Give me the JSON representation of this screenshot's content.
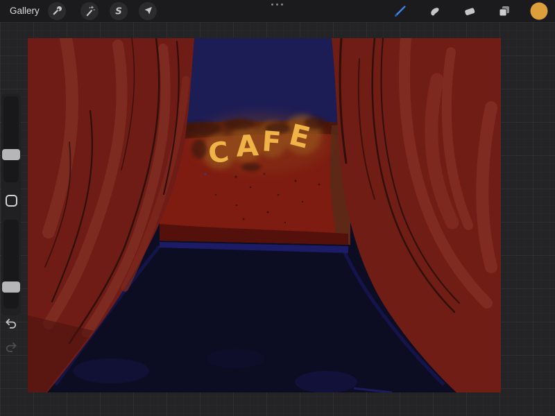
{
  "topbar": {
    "gallery_label": "Gallery",
    "left_tools": [
      {
        "id": "actions",
        "icon": "wrench-icon"
      },
      {
        "id": "adjustments",
        "icon": "magic-wand-icon"
      },
      {
        "id": "selection",
        "icon": "selection-s-icon",
        "glyph": "S"
      },
      {
        "id": "transform",
        "icon": "transform-arrow-icon"
      }
    ],
    "right_tools": [
      {
        "id": "paint",
        "icon": "paintbrush-icon",
        "active": true,
        "accent_color": "#3d85ea"
      },
      {
        "id": "smudge",
        "icon": "smudge-icon"
      },
      {
        "id": "erase",
        "icon": "eraser-icon"
      },
      {
        "id": "layers",
        "icon": "layers-icon"
      },
      {
        "id": "color",
        "icon": "color-swatch",
        "swatch_color": "#dd9f3c"
      }
    ]
  },
  "sidebar": {
    "sliders": [
      {
        "id": "brush-size",
        "handle_position_pct_from_top": 69
      },
      {
        "id": "opacity",
        "handle_position_pct_from_top": 76
      }
    ],
    "has_modify_button": true,
    "history": [
      "undo",
      "redo"
    ]
  },
  "canvas": {
    "artwork": {
      "sign_text": "CAFE",
      "letters": [
        "C",
        "A",
        "F",
        "E"
      ],
      "palette": {
        "curtain": "#6e1c15",
        "curtain_highlight": "#7d2a20",
        "curtain_shadow": "#2f0f0a",
        "sky": "#1d1d56",
        "wall": "#7e1c12",
        "wall_top": "#41150a",
        "wall_right_band": "#582a18",
        "floor": "#0c0c22",
        "floor_highlight": "#1e1e72",
        "sign_yellow": "#efb347",
        "sign_glow": "#9a5a1e"
      }
    }
  }
}
